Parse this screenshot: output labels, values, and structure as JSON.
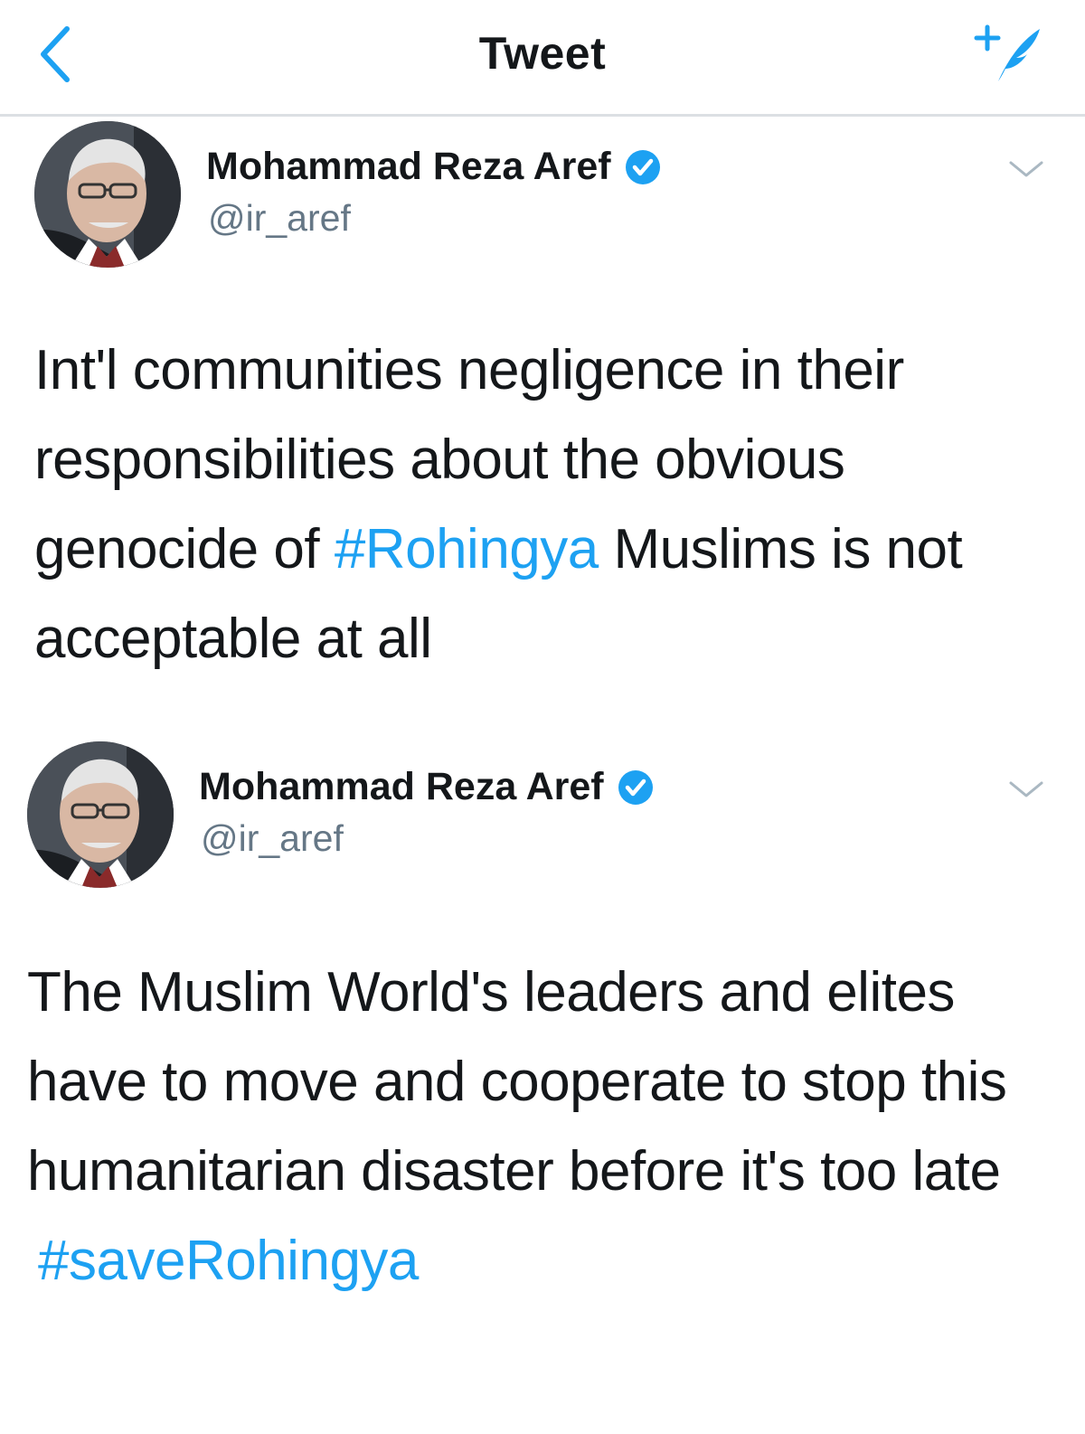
{
  "navbar": {
    "title": "Tweet",
    "back_icon": "chevron-left-icon",
    "compose_icon": "compose-tweet-icon",
    "accent_color": "#1da1f2"
  },
  "tweets": [
    {
      "author_name": "Mohammad Reza Aref",
      "handle": "@ir_aref",
      "verified": true,
      "text_before": "Int'l communities negligence in their responsibilities about the obvious genocide of ",
      "hashtag": "#Rohingya",
      "text_after": " Muslims is not acceptable at all"
    },
    {
      "author_name": "Mohammad Reza Aref",
      "handle": "@ir_aref",
      "verified": true,
      "text_before": "The Muslim World's leaders and elites have to move and cooperate to stop this humanitarian disaster before it's too late",
      "hashtag": "#saveRohingya",
      "text_after": ""
    }
  ]
}
